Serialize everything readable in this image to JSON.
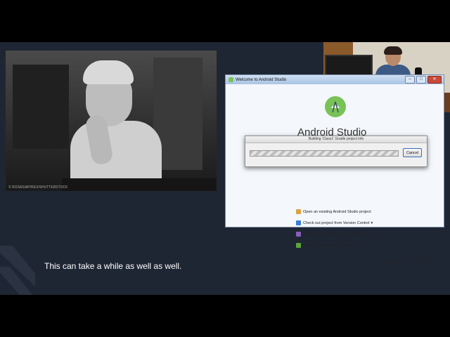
{
  "photo": {
    "caption": "© ROSAS/AP/REX/SHUTTERSTOCK"
  },
  "subtitle": "This can take a while as well as well.",
  "window": {
    "title": "Welcome to Android Studio",
    "minimize": "–",
    "maximize": "□",
    "close": "✕"
  },
  "studio": {
    "name": "Android Studio"
  },
  "dialog": {
    "title": "Building 'Class1' Gradle project info",
    "cancel_label": "Cancel"
  },
  "menu": {
    "open_existing": "Open an existing Android Studio project",
    "checkout": "Check out project from Version Control",
    "checkout_arrow": "▾",
    "import_project": "Import project (Eclipse ADT, Gradle, etc.)",
    "import_sample": "Import an Android code sample"
  },
  "footer": {
    "configure": "Configure ▾",
    "get_help": "Get Help ▾"
  },
  "colors": {
    "slide_bg": "#1f2633",
    "android_green": "#78c257",
    "window_border": "#7a90ad"
  }
}
